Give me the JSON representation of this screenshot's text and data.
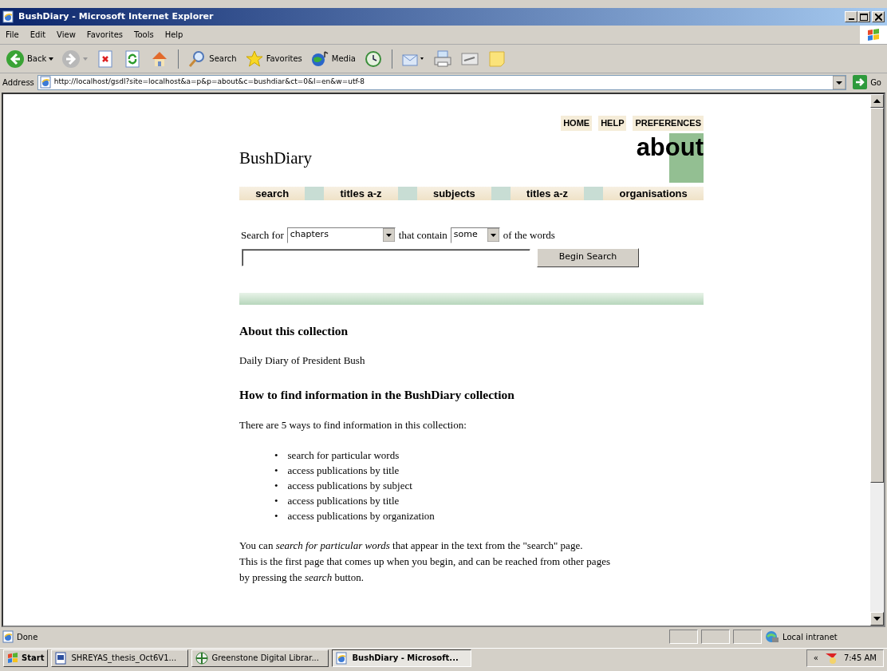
{
  "window": {
    "title": "BushDiary - Microsoft Internet Explorer"
  },
  "menu": [
    "File",
    "Edit",
    "View",
    "Favorites",
    "Tools",
    "Help"
  ],
  "toolbar": [
    {
      "kind": "back",
      "label": "Back"
    },
    {
      "kind": "forward"
    },
    {
      "kind": "stop"
    },
    {
      "kind": "refresh"
    },
    {
      "kind": "home"
    },
    {
      "kind": "search",
      "label": "Search"
    },
    {
      "kind": "favorites",
      "label": "Favorites"
    },
    {
      "kind": "media",
      "label": "Media"
    },
    {
      "kind": "history"
    },
    {
      "kind": "mail"
    },
    {
      "kind": "print"
    },
    {
      "kind": "edit"
    },
    {
      "kind": "note"
    }
  ],
  "address": {
    "label": "Address",
    "url": "http://localhost/gsdl?site=localhost&a=p&p=about&c=bushdiar&ct=0&l=en&w=utf-8",
    "go": "Go"
  },
  "page": {
    "top_links": [
      "HOME",
      "HELP",
      "PREFERENCES"
    ],
    "collection_title": "BushDiary",
    "page_title": "about",
    "nav": [
      "search",
      "titles a-z",
      "subjects",
      "titles a-z",
      "organisations"
    ],
    "search_form": {
      "prefix": "Search for",
      "scope": "chapters",
      "middle": "that contain",
      "mode": "some",
      "suffix": "of the words",
      "button": "Begin Search"
    },
    "content": [
      {
        "kind": "heading",
        "text": "About this collection"
      },
      {
        "kind": "paragraph",
        "text": "Daily Diary of President Bush"
      },
      {
        "kind": "heading",
        "text": "How to find information in the BushDiary collection"
      },
      {
        "kind": "paragraph",
        "text": "There are 5 ways to find information in this collection:"
      },
      {
        "kind": "list",
        "items": [
          {
            "marker": "•",
            "text": "search for particular words"
          },
          {
            "marker": "•",
            "text": "access publications by title"
          },
          {
            "marker": "•",
            "text": "access publications by subject"
          },
          {
            "marker": "•",
            "text": "access publications by title"
          },
          {
            "marker": "•",
            "text": "access publications by organization"
          }
        ]
      },
      {
        "kind": "paragraph",
        "lines": [
          "You can *search for particular words* that appear in the text from the \"search\" page.",
          "This is the first page that comes up when you begin, and can be reached from other pages",
          "by pressing the *search* button."
        ]
      }
    ]
  },
  "status_bar": {
    "text": "Done",
    "zone": "Local intranet"
  },
  "taskbar": {
    "start": "Start",
    "tasks": [
      {
        "kind": "word",
        "label": "SHREYAS_thesis_Oct6V1...",
        "selected": false
      },
      {
        "kind": "greenstone",
        "label": "Greenstone Digital Librar...",
        "selected": false
      },
      {
        "kind": "ie",
        "label": "BushDiary - Microsoft...",
        "selected": true
      }
    ],
    "tray": "«",
    "clock": "7:45 AM"
  }
}
